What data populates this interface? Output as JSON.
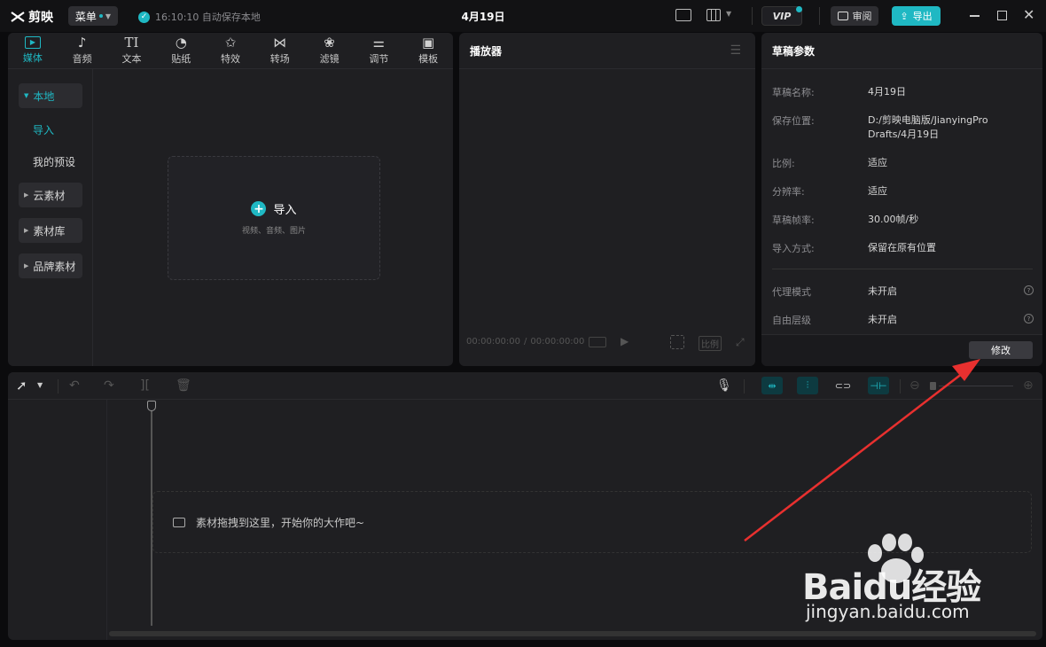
{
  "titlebar": {
    "logo": "剪映",
    "menu": "菜单",
    "autosave": "16:10:10 自动保存本地",
    "title": "4月19日",
    "vip": "VIP",
    "review": "审阅",
    "export": "导出"
  },
  "media": {
    "categories": [
      {
        "label": "媒体",
        "icon": "▶"
      },
      {
        "label": "音频",
        "icon": "♪"
      },
      {
        "label": "文本",
        "icon": "TI"
      },
      {
        "label": "贴纸",
        "icon": "◔"
      },
      {
        "label": "特效",
        "icon": "✩"
      },
      {
        "label": "转场",
        "icon": "⋈"
      },
      {
        "label": "滤镜",
        "icon": "❀"
      },
      {
        "label": "调节",
        "icon": "⚌"
      },
      {
        "label": "模板",
        "icon": "▣"
      }
    ],
    "sidebar": {
      "local": "本地",
      "import": "导入",
      "presets": "我的预设",
      "cloud": "云素材",
      "library": "素材库",
      "brand": "品牌素材"
    },
    "import_label": "导入",
    "import_hint": "视频、音频、图片"
  },
  "player": {
    "title": "播放器",
    "time_current": "00:00:00:00",
    "time_total": "00:00:00:00",
    "ratio": "比例"
  },
  "params": {
    "title": "草稿参数",
    "rows": [
      {
        "label": "草稿名称:",
        "value": "4月19日"
      },
      {
        "label": "保存位置:",
        "value": "D:/剪映电脑版/JianyingPro Drafts/4月19日"
      },
      {
        "label": "比例:",
        "value": "适应"
      },
      {
        "label": "分辨率:",
        "value": "适应"
      },
      {
        "label": "草稿帧率:",
        "value": "30.00帧/秒"
      },
      {
        "label": "导入方式:",
        "value": "保留在原有位置"
      },
      {
        "label": "代理模式",
        "value": "未开启"
      },
      {
        "label": "自由层级",
        "value": "未开启"
      }
    ],
    "modify": "修改"
  },
  "timeline": {
    "drop_hint": "素材拖拽到这里，开始你的大作吧~"
  },
  "watermark": {
    "brand": "Baidu经验",
    "url": "jingyan.baidu.com"
  },
  "colors": {
    "accent": "#1fb8c3",
    "arrow": "#e8302f"
  }
}
